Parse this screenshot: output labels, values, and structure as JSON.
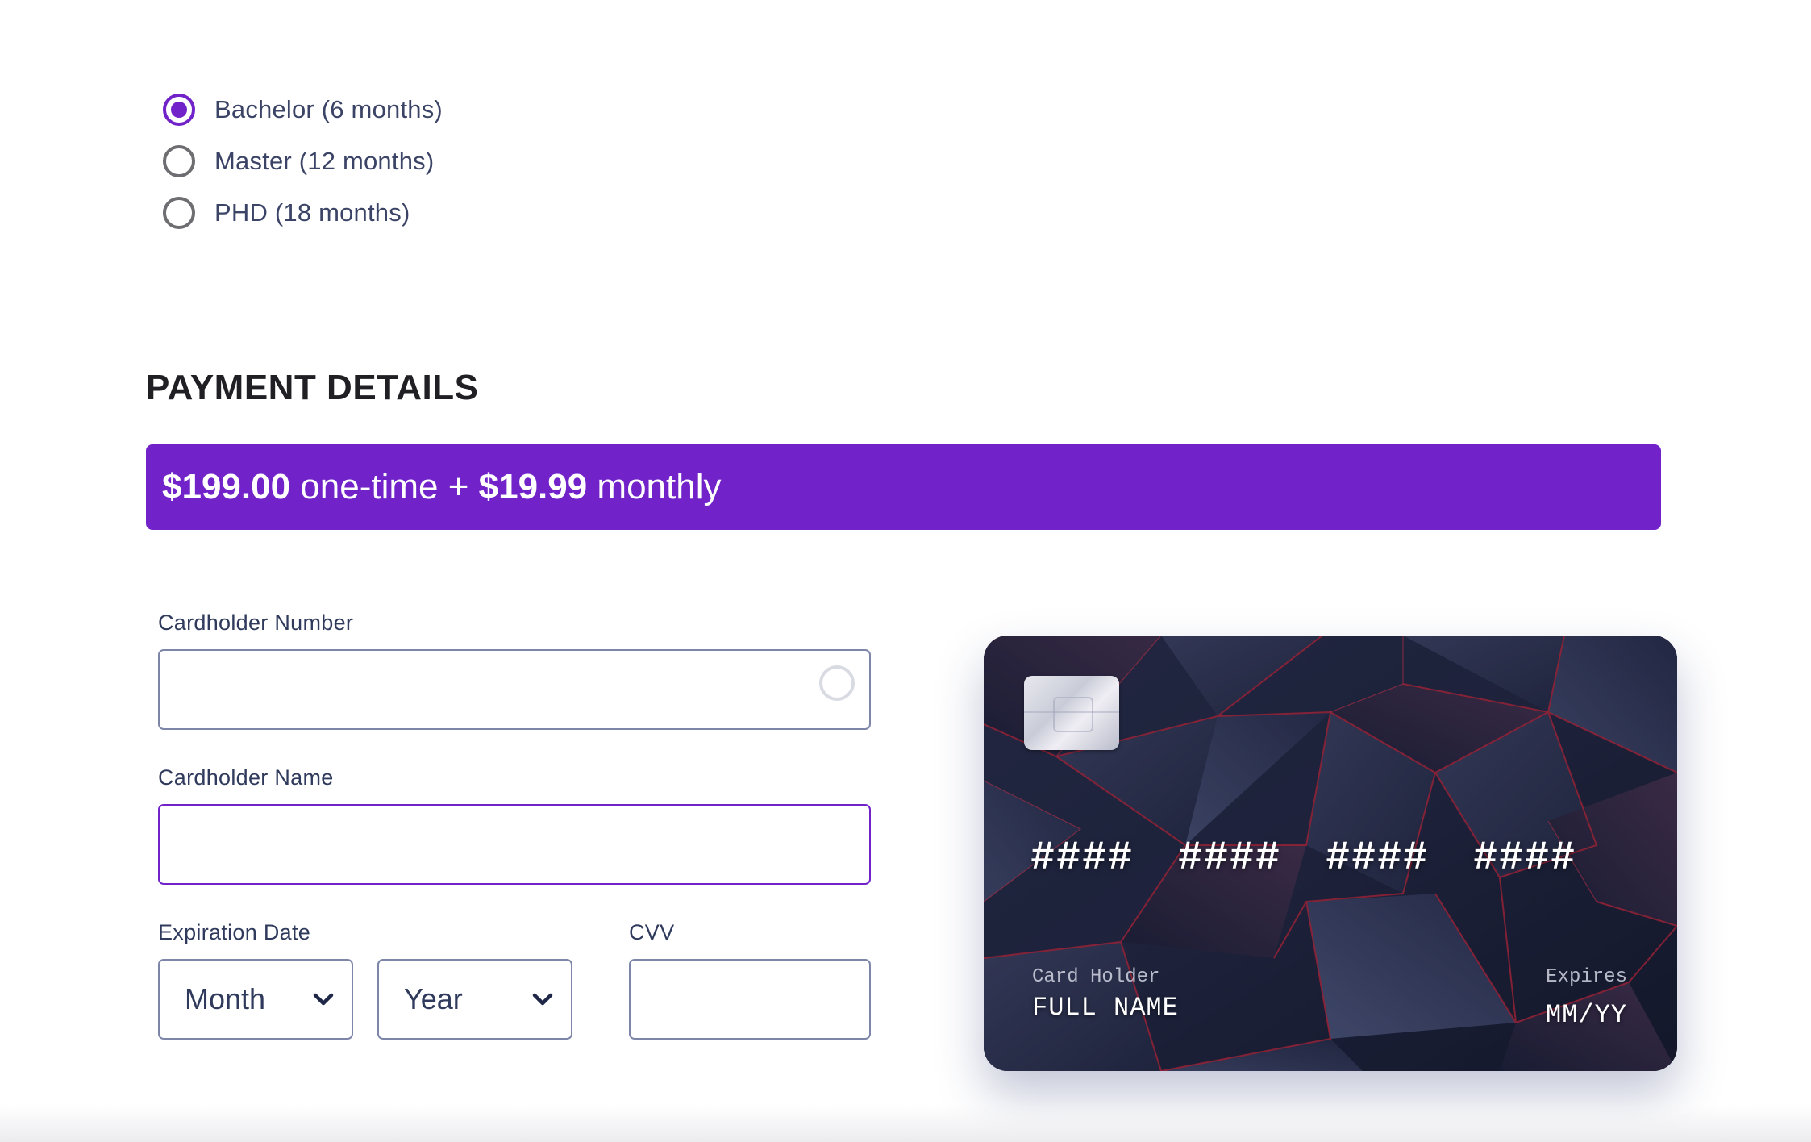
{
  "plans": [
    {
      "label": "Bachelor (6 months)",
      "selected": true
    },
    {
      "label": "Master (12 months)",
      "selected": false
    },
    {
      "label": "PHD (18 months)",
      "selected": false
    }
  ],
  "payment": {
    "title": "PAYMENT DETAILS",
    "price": {
      "one_time_amount": "$199.00",
      "one_time_text": " one-time + ",
      "monthly_amount": "$19.99",
      "monthly_text": " monthly"
    },
    "accent_color": "#7123c9"
  },
  "form": {
    "card_number": {
      "label": "Cardholder Number",
      "value": "",
      "placeholder": ""
    },
    "card_name": {
      "label": "Cardholder Name",
      "value": "",
      "placeholder": ""
    },
    "expiration": {
      "label": "Expiration Date",
      "month": "Month",
      "year": "Year"
    },
    "cvv": {
      "label": "CVV",
      "value": "",
      "placeholder": ""
    }
  },
  "card_preview": {
    "number_groups": [
      "####",
      "####",
      "####",
      "####"
    ],
    "holder_caption": "Card Holder",
    "holder_value": "FULL NAME",
    "expires_caption": "Expires",
    "expires_value": "MM/YY"
  }
}
